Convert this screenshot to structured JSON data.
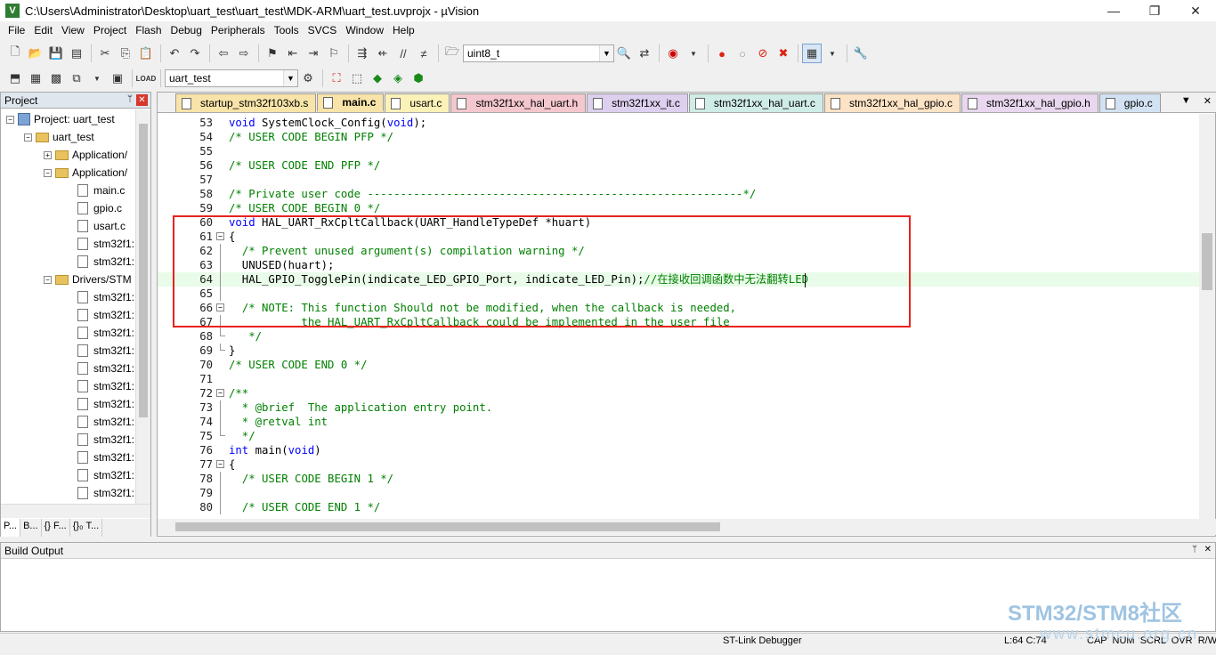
{
  "window": {
    "title": "C:\\Users\\Administrator\\Desktop\\uart_test\\uart_test\\MDK-ARM\\uart_test.uvprojx - µVision",
    "minimize": "—",
    "maximize": "❐",
    "close": "✕"
  },
  "menu": [
    "File",
    "Edit",
    "View",
    "Project",
    "Flash",
    "Debug",
    "Peripherals",
    "Tools",
    "SVCS",
    "Window",
    "Help"
  ],
  "toolbar": {
    "find_combo": "uint8_t",
    "target_combo": "uart_test"
  },
  "project_panel": {
    "title": "Project",
    "pin": "ᛘ",
    "close": "✕",
    "root": "Project: uart_test",
    "target": "uart_test",
    "groups": [
      "Application/",
      "Application/",
      "Drivers/STM"
    ],
    "files": [
      "main.c",
      "gpio.c",
      "usart.c",
      "stm32f1:",
      "stm32f1:"
    ],
    "driver_files": [
      "stm32f1:",
      "stm32f1:",
      "stm32f1:",
      "stm32f1:",
      "stm32f1:",
      "stm32f1:",
      "stm32f1:",
      "stm32f1:",
      "stm32f1:",
      "stm32f1:",
      "stm32f1:",
      "stm32f1:"
    ],
    "tabs": [
      "P...",
      "B...",
      "{} F...",
      "{}₀ T..."
    ]
  },
  "editor": {
    "tabs": [
      "startup_stm32f103xb.s",
      "main.c",
      "usart.c",
      "stm32f1xx_hal_uart.h",
      "stm32f1xx_it.c",
      "stm32f1xx_hal_uart.c",
      "stm32f1xx_hal_gpio.c",
      "stm32f1xx_hal_gpio.h",
      "gpio.c"
    ],
    "tab_colors": [
      "#f8e4a8",
      "#f8e4a8",
      "#fcf2b8",
      "#f4c7ce",
      "#ddd0ee",
      "#d0ece6",
      "#fde3c5",
      "#e8d7ee",
      "#d3e2f3"
    ],
    "active_tab": "main.c",
    "tab_end_down": "▼",
    "tab_end_close": "✕",
    "lines": [
      {
        "n": "53",
        "fold": "",
        "html": "<span class=\"kw\">void</span> SystemClock_Config(<span class=\"kw\">void</span>);"
      },
      {
        "n": "54",
        "fold": "",
        "html": "<span class=\"cm\">/* USER CODE BEGIN PFP */</span>"
      },
      {
        "n": "55",
        "fold": "",
        "html": ""
      },
      {
        "n": "56",
        "fold": "",
        "html": "<span class=\"cm\">/* USER CODE END PFP */</span>"
      },
      {
        "n": "57",
        "fold": "",
        "html": ""
      },
      {
        "n": "58",
        "fold": "",
        "html": "<span class=\"cm\">/* Private user code ---------------------------------------------------------*/</span>"
      },
      {
        "n": "59",
        "fold": "",
        "html": "<span class=\"cm\">/* USER CODE BEGIN 0 */</span>"
      },
      {
        "n": "60",
        "fold": "",
        "html": "<span class=\"kw\">void</span> HAL_UART_RxCpltCallback(UART_HandleTypeDef *huart)"
      },
      {
        "n": "61",
        "fold": "box",
        "html": "{"
      },
      {
        "n": "62",
        "fold": "line",
        "html": "  <span class=\"cm\">/* Prevent unused argument(s) compilation warning */</span>"
      },
      {
        "n": "63",
        "fold": "line",
        "html": "  UNUSED(huart);"
      },
      {
        "n": "64",
        "fold": "line",
        "hl": true,
        "html": "  HAL_GPIO_TogglePin(indicate_LED_GPIO_Port, indicate_LED_Pin);<span class=\"cm\">//在接收回调函数中无法翻转LED</span>"
      },
      {
        "n": "65",
        "fold": "line",
        "html": ""
      },
      {
        "n": "66",
        "fold": "box",
        "html": "  <span class=\"cm\">/* NOTE: This function Should not be modified, when the callback is needed,</span>"
      },
      {
        "n": "67",
        "fold": "line",
        "html": "<span class=\"cm\">           the HAL_UART_RxCpltCallback could be implemented in the user file</span>"
      },
      {
        "n": "68",
        "fold": "end",
        "html": "   <span class=\"cm\">*/</span>"
      },
      {
        "n": "69",
        "fold": "end",
        "html": "}"
      },
      {
        "n": "70",
        "fold": "",
        "html": "<span class=\"cm\">/* USER CODE END 0 */</span>"
      },
      {
        "n": "71",
        "fold": "",
        "html": ""
      },
      {
        "n": "72",
        "fold": "box",
        "html": "<span class=\"cm\">/**</span>"
      },
      {
        "n": "73",
        "fold": "line",
        "html": "<span class=\"cm\">  * @brief  The application entry point.</span>"
      },
      {
        "n": "74",
        "fold": "line",
        "html": "<span class=\"cm\">  * @retval int</span>"
      },
      {
        "n": "75",
        "fold": "end",
        "html": "<span class=\"cm\">  */</span>"
      },
      {
        "n": "76",
        "fold": "",
        "html": "<span class=\"kw\">int</span> main(<span class=\"kw\">void</span>)"
      },
      {
        "n": "77",
        "fold": "box",
        "html": "{"
      },
      {
        "n": "78",
        "fold": "line",
        "html": "  <span class=\"cm\">/* USER CODE BEGIN 1 */</span>"
      },
      {
        "n": "79",
        "fold": "line",
        "html": ""
      },
      {
        "n": "80",
        "fold": "line",
        "html": "  <span class=\"cm\">/* USER CODE END 1 */</span>"
      }
    ]
  },
  "build_output": {
    "title": "Build Output",
    "pin": "ᛘ",
    "close": "✕"
  },
  "status": {
    "debugger": "ST-Link Debugger",
    "position": "L:64 C:74",
    "flags": "CAP  NUM  SCRL  OVR  R/W"
  },
  "watermark": {
    "line1": "STM32/STM8社区",
    "line2": "www.stmcu.org.cn"
  }
}
